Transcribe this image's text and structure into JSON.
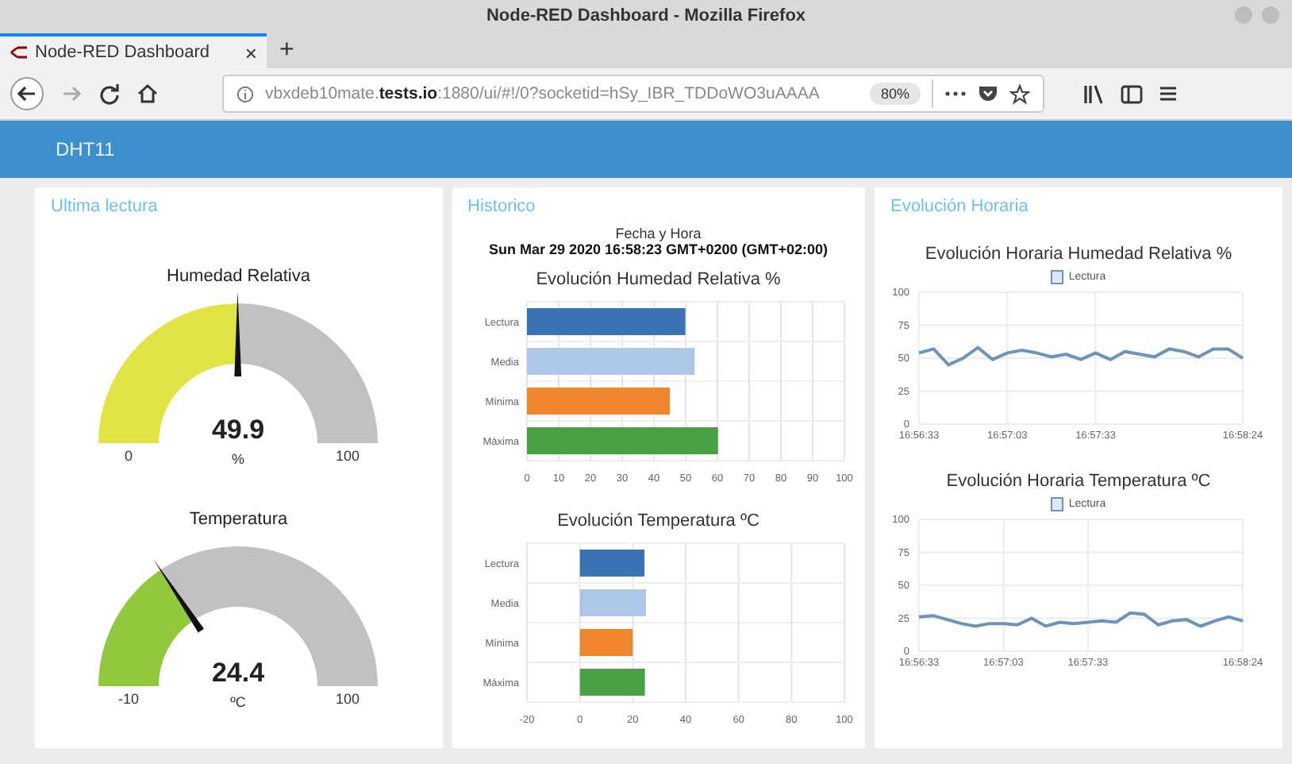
{
  "window": {
    "title": "Node-RED Dashboard - Mozilla Firefox"
  },
  "tabs": [
    {
      "label": "Node-RED Dashboard",
      "close": "×",
      "selected": true
    }
  ],
  "new_tab": "+",
  "address_bar": {
    "url": "vbxdeb10mate.**tests.io**:1880/ui/#!/0?socketid=hSy_IBR_TDDoWO3uAAAA",
    "zoom": "80%"
  },
  "header": {
    "title": "DHT11"
  },
  "groups": [
    {
      "kind": "gauges",
      "title": "Ultima lectura",
      "gauges": [
        {
          "title": "Humedad Relativa",
          "value": "49.9",
          "unit": "%",
          "min": "0",
          "max": "100",
          "color": "#e1e346"
        },
        {
          "title": "Temperatura",
          "value": "24.4",
          "unit": "ºC",
          "min": "-10",
          "max": "100",
          "color": "#92c83e"
        }
      ]
    },
    {
      "kind": "charts",
      "title": "Historico",
      "timestamp_label": "Fecha y Hora",
      "timestamp": "Sun Mar 29 2020 16:58:23 GMT+0200 (GMT+02:00)",
      "charts": [
        {
          "chart_data": {
            "type": "bar",
            "orientation": "horizontal",
            "grid": true,
            "title": "Evolución Humedad Relativa %",
            "categories": [
              "Lectura",
              "Media",
              "Mínima",
              "Máxima"
            ],
            "values": [
              49.9,
              52.8,
              45,
              60.2
            ],
            "colors": [
              "#3a72b4",
              "#aec7e8",
              "#f0852f",
              "#4aa143"
            ],
            "xlim": [
              0,
              100
            ],
            "xticks": [
              0,
              10,
              20,
              30,
              40,
              50,
              60,
              70,
              80,
              90,
              100
            ]
          }
        },
        {
          "chart_data": {
            "type": "bar",
            "orientation": "horizontal",
            "grid": true,
            "title": "Evolución Temperatura ºC",
            "categories": [
              "Lectura",
              "Media",
              "Mínima",
              "Máxima"
            ],
            "values": [
              24.4,
              25,
              20,
              24.6
            ],
            "colors": [
              "#3a72b4",
              "#aec7e8",
              "#f0852f",
              "#4aa143"
            ],
            "xlim": [
              -20,
              100
            ],
            "xticks": [
              -20,
              0,
              20,
              40,
              60,
              80,
              100
            ]
          }
        }
      ]
    },
    {
      "kind": "charts",
      "title": "Evolución Horaria",
      "charts": [
        {
          "chart_data": {
            "type": "line",
            "grid": true,
            "title": "Evolución Horaria Humedad Relativa %",
            "categories": [
              "16:56:33",
              null,
              null,
              null,
              null,
              null,
              "16:57:03",
              null,
              null,
              null,
              null,
              null,
              "16:57:33",
              null,
              null,
              null,
              null,
              null,
              null,
              null,
              null,
              null,
              "16:58:24"
            ],
            "series": [
              {
                "name": "Lectura",
                "color": "#6b93bd",
                "values": [
                  54,
                  57,
                  45,
                  50,
                  58,
                  49,
                  54,
                  56,
                  54,
                  51,
                  53,
                  49,
                  54,
                  49,
                  55,
                  53,
                  51,
                  57,
                  55,
                  51,
                  57,
                  57,
                  50
                ]
              }
            ],
            "ylim": [
              0,
              100
            ],
            "yticks": [
              0,
              25,
              50,
              75,
              100
            ]
          }
        },
        {
          "chart_data": {
            "type": "line",
            "grid": true,
            "title": "Evolución Horaria Temperatura ºC",
            "categories": [
              "16:56:33",
              null,
              null,
              null,
              null,
              null,
              "16:57:03",
              null,
              null,
              null,
              null,
              null,
              "16:57:33",
              null,
              null,
              null,
              null,
              null,
              null,
              null,
              null,
              null,
              null,
              "16:58:24"
            ],
            "series": [
              {
                "name": "Lectura",
                "color": "#6b93bd",
                "values": [
                  26,
                  27,
                  24,
                  21,
                  19,
                  21,
                  21,
                  20,
                  25,
                  19,
                  22,
                  21,
                  22,
                  23,
                  22,
                  29,
                  28,
                  20,
                  23,
                  24,
                  19,
                  23,
                  26,
                  23
                ]
              }
            ],
            "ylim": [
              0,
              100
            ],
            "yticks": [
              0,
              25,
              50,
              75,
              100
            ]
          }
        }
      ]
    }
  ]
}
